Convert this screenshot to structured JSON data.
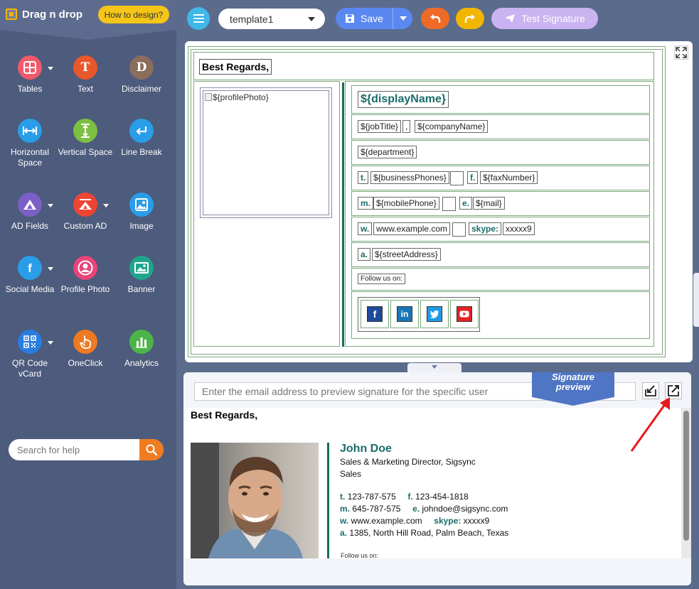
{
  "sidebar": {
    "brand": "Drag n drop",
    "how_to": "How to design?",
    "tools": [
      {
        "label": "Tables",
        "icon": "table-icon",
        "color": "#f05a6a"
      },
      {
        "label": "Text",
        "icon": "text-icon",
        "color": "#e8572a",
        "glyph": "T"
      },
      {
        "label": "Disclaimer",
        "icon": "disclaimer-icon",
        "color": "#8a6d5b",
        "glyph": "D"
      },
      {
        "label": "Horizontal Space",
        "icon": "horizontal-space-icon",
        "color": "#2a9de8"
      },
      {
        "label": "Vertical Space",
        "icon": "vertical-space-icon",
        "color": "#7cc043"
      },
      {
        "label": "Line Break",
        "icon": "line-break-icon",
        "color": "#2a9de8"
      },
      {
        "label": "AD Fields",
        "icon": "ad-fields-icon",
        "color": "#7b5fc7"
      },
      {
        "label": "Custom AD",
        "icon": "custom-ad-icon",
        "color": "#ee4433"
      },
      {
        "label": "Image",
        "icon": "image-icon",
        "color": "#2a9de8"
      },
      {
        "label": "Social Media",
        "icon": "social-media-icon",
        "color": "#2a9de8",
        "glyph": "f"
      },
      {
        "label": "Profile Photo",
        "icon": "profile-photo-icon",
        "color": "#e8457a"
      },
      {
        "label": "Banner",
        "icon": "banner-icon",
        "color": "#1fa58c"
      },
      {
        "label": "QR Code vCard",
        "icon": "qr-code-icon",
        "color": "#2a7de0"
      },
      {
        "label": "OneClick",
        "icon": "one-click-icon",
        "color": "#ee7a22"
      },
      {
        "label": "Analytics",
        "icon": "analytics-icon",
        "color": "#4cb548"
      }
    ],
    "search_placeholder": "Search for help"
  },
  "toolbar": {
    "template": "template1",
    "save_label": "Save",
    "test_label": "Test Signature"
  },
  "editor": {
    "regards": "Best Regards,",
    "profile_photo": "${profilePhoto}",
    "display_name": "${displayName}",
    "job_title": "${jobTitle}",
    "comma": ",",
    "company_name": "${companyName}",
    "department": "${department}",
    "t_label": "t.",
    "business_phones": "${businessPhones}",
    "f_label": "f.",
    "fax_number": "${faxNumber}",
    "m_label": "m.",
    "mobile_phone": "${mobilePhone}",
    "e_label": "e.",
    "mail": "${mail}",
    "w_label": "w.",
    "website": "www.example.com",
    "skype_label": "skype:",
    "skype": "xxxxx9",
    "a_label": "a.",
    "street_address": "${streetAddress}",
    "follow": "Follow us on:",
    "social": [
      {
        "icon": "facebook-icon",
        "glyph": "f",
        "color": "#1e4a9a"
      },
      {
        "icon": "linkedin-icon",
        "glyph": "in",
        "color": "#1a75b8"
      },
      {
        "icon": "twitter-icon",
        "glyph": "",
        "color": "#1e9be8"
      },
      {
        "icon": "youtube-icon",
        "glyph": "",
        "color": "#e52222"
      }
    ]
  },
  "preview": {
    "email_placeholder": "Enter the email address to preview signature for the specific user",
    "ribbon_line1": "Signature",
    "ribbon_line2": "preview",
    "regards": "Best Regards,",
    "name": "John Doe",
    "title_line": "Sales & Marketing Director, Sigsync",
    "department": "Sales",
    "t_label": "t.",
    "phone": "123-787-575",
    "f_label": "f.",
    "fax": "123-454-1818",
    "m_label": "m.",
    "mobile": "645-787-575",
    "e_label": "e.",
    "email": "johndoe@sigsync.com",
    "w_label": "w.",
    "website": "www.example.com",
    "skype_label": "skype:",
    "skype": "xxxxx9",
    "a_label": "a.",
    "address": "1385, North Hill Road, Palm Beach, Texas",
    "follow": "Follow us on:"
  }
}
